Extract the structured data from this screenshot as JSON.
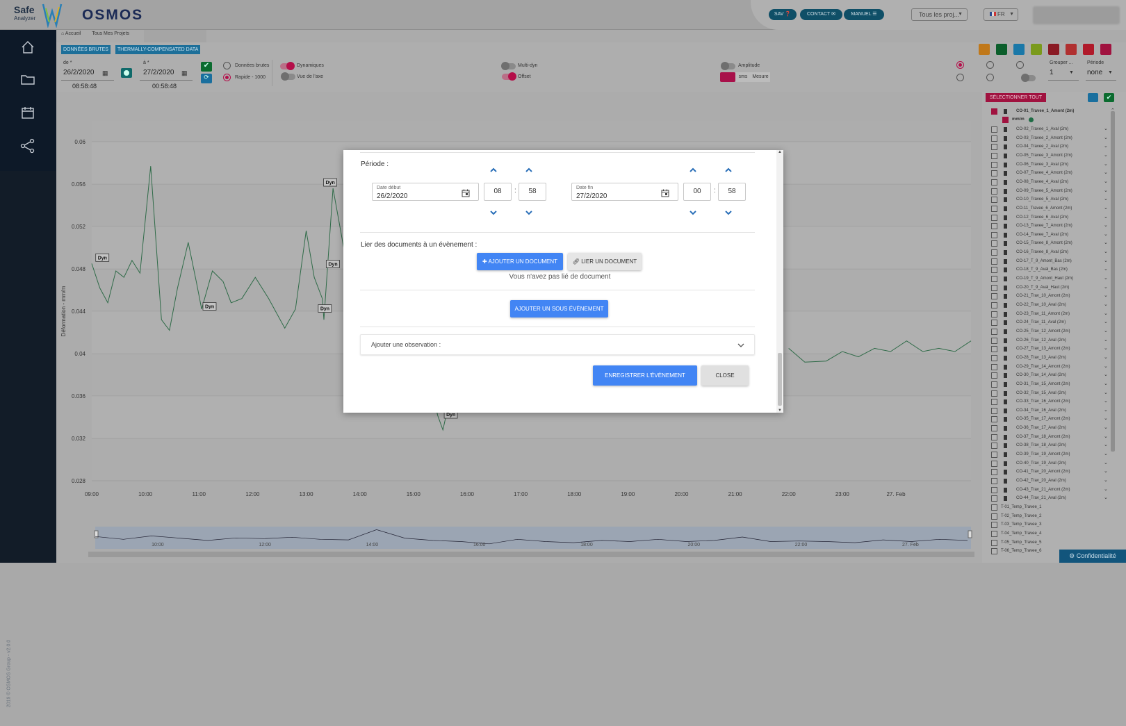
{
  "header": {
    "logo_safe": "Safe",
    "logo_analyzer": "Analyzer",
    "brand": "OSMOS",
    "sav": "SAV",
    "contact": "CONTACT",
    "manuel": "MANUEL",
    "projects_select": "Tous les proj...",
    "language": "FR"
  },
  "sidebar": {
    "version": "2019 © OSMOS Group - v2.0.0"
  },
  "breadcrumb": {
    "home": "Accueil",
    "projects": "Tous Mes Projets"
  },
  "toolbar": {
    "tag_raw": "DONNÉES BRUTES",
    "tag_thermal": "THERMALLY-COMPENSATED DATA",
    "from_label": "de *",
    "from_date": "26/2/2020",
    "from_time": "08:58:48",
    "to_label": "à *",
    "to_date": "27/2/2020",
    "to_time": "00:58:48",
    "opt_raw": "Données brutes",
    "opt_fast": "Rapide - 1000",
    "opt_dynamic": "Dynamiques",
    "opt_axis_view": "Vue de l'axe",
    "opt_multidyn": "Multi-dyn",
    "opt_offset": "Offset",
    "opt_amplitude": "Amplitude",
    "amp_sms": "sms",
    "amp_mesure": "Mesure",
    "group_label": "Grouper ...",
    "group_value": "1",
    "period_label": "Période",
    "period_value": "none"
  },
  "chart_data": {
    "type": "line",
    "ylabel": "Déformation - mm/m",
    "ylim": [
      0.028,
      0.06
    ],
    "yticks": [
      "0.06",
      "0.056",
      "0.052",
      "0.048",
      "0.044",
      "0.04",
      "0.036",
      "0.032",
      "0.028"
    ],
    "xticks": [
      "09:00",
      "10:00",
      "11:00",
      "12:00",
      "13:00",
      "14:00",
      "15:00",
      "16:00",
      "17:00",
      "18:00",
      "19:00",
      "20:00",
      "21:00",
      "22:00",
      "23:00",
      "27. Feb"
    ],
    "navigator_ticks": [
      "10:00",
      "12:00",
      "14:00",
      "16:00",
      "18:00",
      "20:00",
      "22:00",
      "27. Feb"
    ],
    "series": [
      {
        "name": "CO-01_Travee_1_Amont",
        "x": [
          9.0,
          9.15,
          9.3,
          9.45,
          9.6,
          9.75,
          9.9,
          10.1,
          10.3,
          10.45,
          10.6,
          10.8,
          10.95,
          11.05,
          11.25,
          11.45,
          11.6,
          11.8,
          12.05,
          12.3,
          12.6,
          12.8,
          13.0,
          13.15,
          13.3,
          13.33,
          13.5,
          13.8,
          14.1,
          14.5,
          14.8,
          15.1,
          15.3,
          15.45,
          15.55,
          15.7,
          15.9
        ],
        "y": [
          0.0485,
          0.0462,
          0.0448,
          0.0478,
          0.0472,
          0.0488,
          0.0476,
          0.0577,
          0.0432,
          0.0422,
          0.0462,
          0.0505,
          0.0468,
          0.0442,
          0.0478,
          0.0468,
          0.0448,
          0.0452,
          0.0472,
          0.0452,
          0.0424,
          0.0442,
          0.0516,
          0.0472,
          0.0452,
          0.0432,
          0.0556,
          0.0472,
          0.0452,
          0.0422,
          0.0432,
          0.0412,
          0.0382,
          0.0342,
          0.0328,
          0.0362,
          0.0392
        ]
      }
    ],
    "annotations": [
      "Dyn",
      "Dyn",
      "Dyn",
      "Dyn",
      "Dyn",
      "Dyn",
      "Dyn",
      "Dyn"
    ]
  },
  "right_panel": {
    "select_all": "SÉLECTIONNER TOUT",
    "first_sensor": "CO-01_Travee_1_Amont (2m)",
    "first_unit": "mm/m",
    "sensors": [
      "CO-02_Travee_1_Aval (2m)",
      "CO-03_Travee_2_Amont (2m)",
      "CO-04_Travee_2_Aval (2m)",
      "CO-05_Travee_3_Amont (2m)",
      "CO-06_Travee_3_Aval (2m)",
      "CO-07_Travee_4_Amont (2m)",
      "CO-08_Travee_4_Aval (2m)",
      "CO-09_Travee_5_Amont (2m)",
      "CO-10_Travee_5_Aval (2m)",
      "CO-11_Travee_6_Amont (2m)",
      "CO-12_Travee_6_Aval (2m)",
      "CO-13_Travee_7_Amont (2m)",
      "CO-14_Travee_7_Aval (2m)",
      "CO-15_Travee_8_Amont (2m)",
      "CO-16_Travee_8_Aval (2m)",
      "CO-17_T_9_Amont_Bas (2m)",
      "CO-18_T_9_Aval_Bas (2m)",
      "CO-19_T_9_Amont_Haut (2m)",
      "CO-20_T_9_Aval_Haut (2m)",
      "CO-21_Trav_10_Amont (2m)",
      "CO-22_Trav_10_Aval (2m)",
      "CO-23_Trav_11_Amont (2m)",
      "CO-24_Trav_11_Aval (2m)",
      "CO-25_Trav_12_Amont (2m)",
      "CO-26_Trav_12_Aval (2m)",
      "CO-27_Trav_13_Amont (2m)",
      "CO-28_Trav_13_Aval (2m)",
      "CO-29_Trav_14_Amont (2m)",
      "CO-30_Trav_14_Aval (2m)",
      "CO-31_Trav_15_Amont (2m)",
      "CO-32_Trav_15_Aval (2m)",
      "CO-33_Trav_16_Amont (2m)",
      "CO-34_Trav_16_Aval (2m)",
      "CO-35_Trav_17_Amont (2m)",
      "CO-36_Trav_17_Aval (2m)",
      "CO-37_Trav_18_Amont (2m)",
      "CO-38_Trav_18_Aval (2m)",
      "CO-39_Trav_19_Amont (2m)",
      "CO-40_Trav_19_Aval (2m)",
      "CO-41_Trav_20_Amont (2m)",
      "CO-42_Trav_20_Aval (2m)",
      "CO-43_Trav_21_Amont (2m)",
      "CO-44_Trav_21_Aval (2m)"
    ],
    "temps": [
      "T-01_Temp_Travee_1",
      "T-02_Temp_Travee_2",
      "T-03_Temp_Travee_3",
      "T-04_Temp_Travee_4",
      "T-05_Temp_Travee_5",
      "T-06_Temp_Travee_6"
    ],
    "privacy": "Confidentialité"
  },
  "modal": {
    "period_title": "Période :",
    "start_label": "Date début",
    "start_date": "26/2/2020",
    "start_hour": "08",
    "start_min": "58",
    "end_label": "Date fin",
    "end_date": "27/2/2020",
    "end_hour": "00",
    "end_min": "58",
    "docs_title": "Lier des documents à un évènement :",
    "add_doc": "AJOUTER UN DOCUMENT",
    "link_doc": "LIER UN DOCUMENT",
    "no_doc": "Vous n'avez pas lié de document",
    "add_sub": "AJOUTER UN SOUS ÉVÈNEMENT",
    "observation": "Ajouter une observation :",
    "save": "ENREGISTRER L'ÉVÈNEMENT",
    "close": "CLOSE"
  },
  "colors": {
    "sidebar": "#0d1928",
    "accent_blue": "#4285f4",
    "accent_pink": "#b40e49",
    "line": "#2f6b48"
  }
}
